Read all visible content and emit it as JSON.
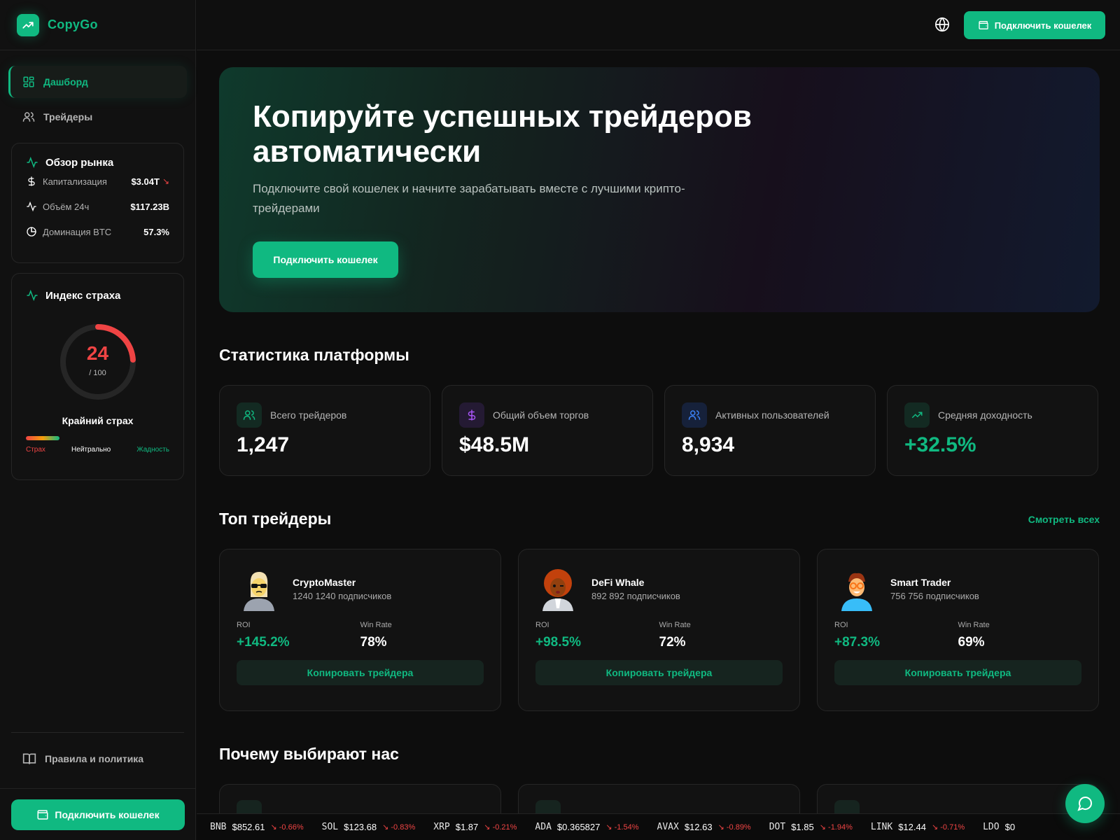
{
  "brand": {
    "name": "CopyGo",
    "accent": "#10b981"
  },
  "sidebar": {
    "nav": [
      {
        "label": "Дашборд",
        "icon": "dashboard-icon",
        "active": true
      },
      {
        "label": "Трейдеры",
        "icon": "users-icon",
        "active": false
      }
    ],
    "market": {
      "title": "Обзор рынка",
      "rows": [
        {
          "label": "Капитализация",
          "value": "$3.04T",
          "trend": "↘",
          "icon": "dollar-icon"
        },
        {
          "label": "Объём 24ч",
          "value": "$117.23B",
          "icon": "activity-icon"
        },
        {
          "label": "Доминация BTC",
          "value": "57.3%",
          "icon": "pie-icon"
        }
      ]
    },
    "fear": {
      "title": "Индекс страха",
      "value": "24",
      "max": "/ 100",
      "level": 0.24,
      "label": "Крайний страх",
      "legend": [
        "Страх",
        "Нейтрально",
        "Жадность"
      ]
    },
    "rules_label": "Правила и политика",
    "connect_label": "Подключить кошелек"
  },
  "header": {
    "connect_label": "Подключить кошелек"
  },
  "hero": {
    "title": "Копируйте успешных трейдеров автоматически",
    "subtitle": "Подключите свой кошелек и начните зарабатывать вместе с лучшими крипто-трейдерами",
    "button": "Подключить кошелек"
  },
  "stats": {
    "title": "Статистика платформы",
    "items": [
      {
        "label": "Всего трейдеров",
        "value": "1,247",
        "icon": "users-icon",
        "color": "#10b981"
      },
      {
        "label": "Общий объем торгов",
        "value": "$48.5M",
        "icon": "dollar-icon",
        "color": "#a855f7"
      },
      {
        "label": "Активных пользователей",
        "value": "8,934",
        "icon": "users-icon",
        "color": "#3b82f6"
      },
      {
        "label": "Средняя доходность",
        "value": "+32.5%",
        "icon": "trending-up-icon",
        "color": "#10b981"
      }
    ]
  },
  "traders": {
    "title": "Топ трейдеры",
    "see_all": "Смотреть всех",
    "roi_label": "ROI",
    "winrate_label": "Win Rate",
    "copy_label": "Копировать трейдера",
    "items": [
      {
        "name": "CryptoMaster",
        "subs": "1240 1240 подписчиков",
        "roi": "+145.2%",
        "winrate": "78%"
      },
      {
        "name": "DeFi Whale",
        "subs": "892 892 подписчиков",
        "roi": "+98.5%",
        "winrate": "72%"
      },
      {
        "name": "Smart Trader",
        "subs": "756 756 подписчиков",
        "roi": "+87.3%",
        "winrate": "69%"
      }
    ]
  },
  "why": {
    "title": "Почему выбирают нас"
  },
  "ticker": [
    {
      "sym": "BNB",
      "price": "$852.61",
      "chg": "-0.66%"
    },
    {
      "sym": "SOL",
      "price": "$123.68",
      "chg": "-0.83%"
    },
    {
      "sym": "XRP",
      "price": "$1.87",
      "chg": "-0.21%"
    },
    {
      "sym": "ADA",
      "price": "$0.365827",
      "chg": "-1.54%"
    },
    {
      "sym": "AVAX",
      "price": "$12.63",
      "chg": "-0.89%"
    },
    {
      "sym": "DOT",
      "price": "$1.85",
      "chg": "-1.94%"
    },
    {
      "sym": "LINK",
      "price": "$12.44",
      "chg": "-0.71%"
    },
    {
      "sym": "LDO",
      "price": "$0",
      "chg": ""
    }
  ]
}
